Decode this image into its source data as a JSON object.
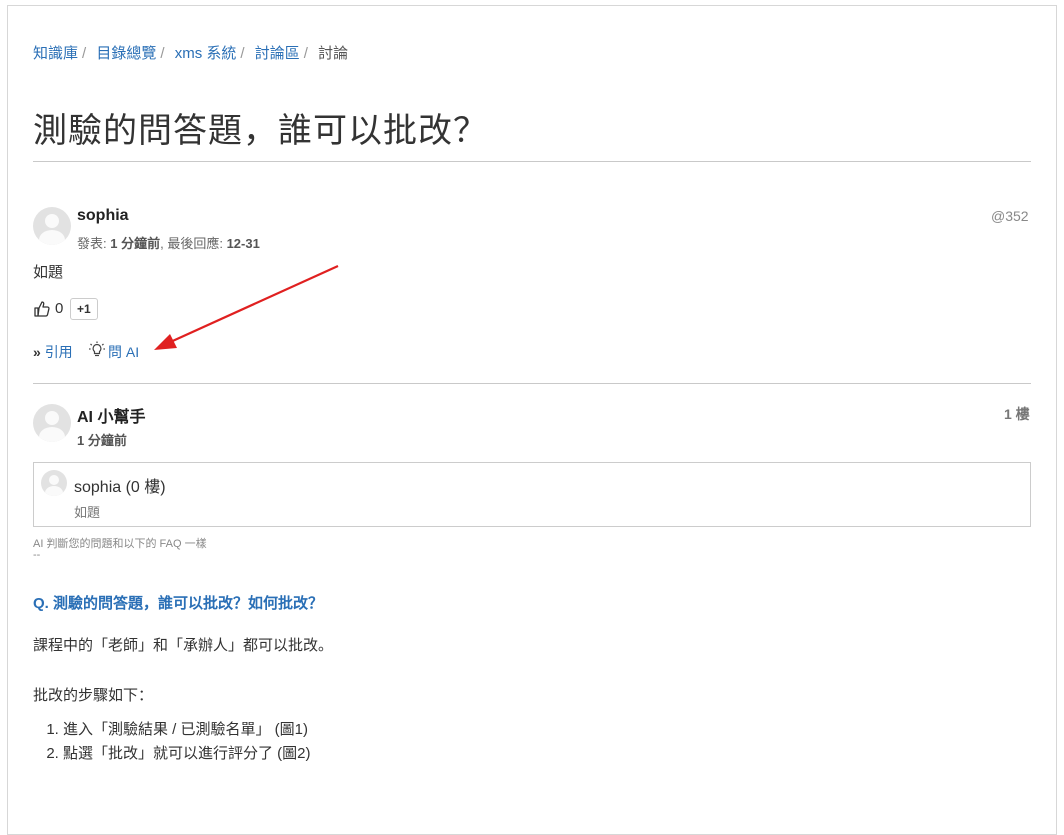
{
  "breadcrumb": [
    "知識庫",
    "目錄總覽",
    "xms 系統",
    "討論區"
  ],
  "breadcrumb_current": "討論",
  "page_title": "測驗的問答題，誰可以批改？",
  "post": {
    "author": "sophia",
    "meta_posted_label": "發表:",
    "meta_posted_value": "1 分鐘前",
    "meta_reply_label": "最後回應:",
    "meta_reply_value": "12-31",
    "id": "@352",
    "body": "如題",
    "like_count": "0",
    "plus_label": "+1",
    "quote_label": "引用",
    "ask_ai_label": "問 AI"
  },
  "reply": {
    "author": "AI 小幫手",
    "time": "1 分鐘前",
    "floor": "1 樓",
    "quote_name": "sophia (0 樓)",
    "quote_text": "如題",
    "note": "AI 判斷您的問題和以下的 FAQ 一樣",
    "note_sep": "--",
    "faq_question": "Q. 測驗的問答題，誰可以批改？如何批改？",
    "answer_line1": "課程中的「老師」和「承辦人」都可以批改。",
    "answer_line2": "批改的步驟如下：",
    "steps": [
      "進入「測驗結果 / 已測驗名單」 (圖1)",
      "點選「批改」就可以進行評分了 (圖2)"
    ]
  },
  "colors": {
    "link": "#2a6fb6",
    "annotation_arrow": "#e02020"
  },
  "icons": {
    "like": "thumbs-up-icon",
    "quote": "double-chevron-icon",
    "ask_ai": "lightbulb-icon",
    "avatar": "default-avatar-icon"
  }
}
